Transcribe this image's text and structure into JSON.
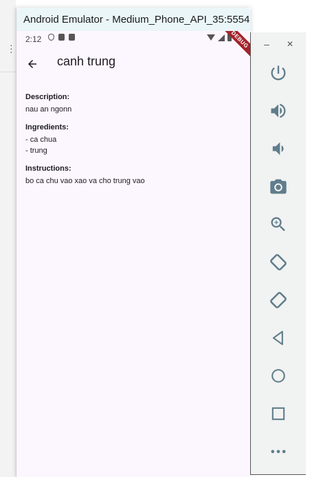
{
  "window": {
    "title": "Android Emulator - Medium_Phone_API_35:5554"
  },
  "status_bar": {
    "time": "2:12",
    "debug_banner": "DEBUG"
  },
  "app_bar": {
    "title": "canh trung"
  },
  "recipe": {
    "description_label": "Description:",
    "description": "nau an ngonn",
    "ingredients_label": "Ingredients:",
    "ingredients": [
      "- ca chua",
      "- trung"
    ],
    "instructions_label": "Instructions:",
    "instructions": "bo ca chu vao xao va cho trung vao"
  },
  "side_panel": {
    "minimize_label": "–",
    "close_label": "✕",
    "controls": [
      "power-icon",
      "volume-up-icon",
      "volume-down-icon",
      "camera-icon",
      "zoom-icon",
      "rotate-left-icon",
      "rotate-right-icon",
      "back-icon",
      "home-icon",
      "overview-icon",
      "more-icon"
    ]
  },
  "colors": {
    "icon": "#607d8b",
    "phone_bg": "#fcf6ff",
    "title_bar": "#eaf6f8",
    "debug": "#a4242b"
  }
}
